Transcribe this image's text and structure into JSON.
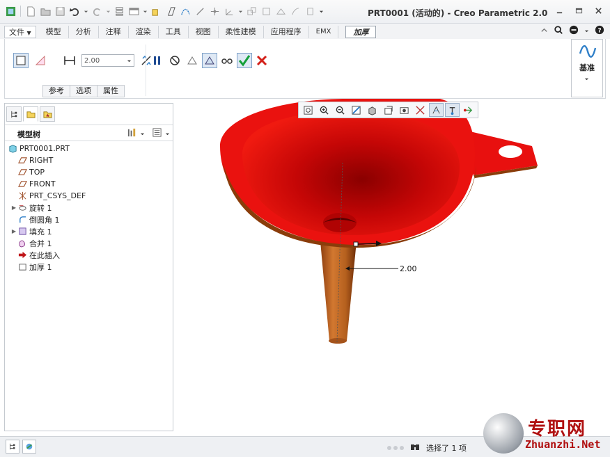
{
  "window": {
    "title": "PRT0001 (活动的) - Creo Parametric 2.0"
  },
  "ribbon_tabs": [
    {
      "label": "文件"
    },
    {
      "label": "模型"
    },
    {
      "label": "分析"
    },
    {
      "label": "注释"
    },
    {
      "label": "渲染"
    },
    {
      "label": "工具"
    },
    {
      "label": "视图"
    },
    {
      "label": "柔性建模"
    },
    {
      "label": "应用程序"
    },
    {
      "label": "EMX"
    },
    {
      "label": "加厚"
    }
  ],
  "ribbon": {
    "thickness_value": "2.00",
    "subtabs": [
      {
        "label": "参考"
      },
      {
        "label": "选项"
      },
      {
        "label": "属性"
      }
    ],
    "datum_label": "基准"
  },
  "model_tree": {
    "title": "模型树",
    "items": [
      {
        "label": "PRT0001.PRT",
        "icon": "part-icon",
        "expandable": false
      },
      {
        "label": "RIGHT",
        "icon": "datum-plane-icon",
        "expandable": false
      },
      {
        "label": "TOP",
        "icon": "datum-plane-icon",
        "expandable": false
      },
      {
        "label": "FRONT",
        "icon": "datum-plane-icon",
        "expandable": false
      },
      {
        "label": "PRT_CSYS_DEF",
        "icon": "csys-icon",
        "expandable": false
      },
      {
        "label": "旋转 1",
        "icon": "revolve-icon",
        "expandable": true
      },
      {
        "label": "倒圆角 1",
        "icon": "round-icon",
        "expandable": false
      },
      {
        "label": "填充 1",
        "icon": "fill-icon",
        "expandable": true
      },
      {
        "label": "合并 1",
        "icon": "merge-icon",
        "expandable": false
      },
      {
        "label": "在此插入",
        "icon": "insert-here-icon",
        "expandable": false
      },
      {
        "label": "加厚 1",
        "icon": "thicken-icon",
        "expandable": false
      }
    ]
  },
  "graphics": {
    "dimension_label": "2.00"
  },
  "status": {
    "text": "选择了 1 项"
  },
  "watermark": {
    "cn": "专职网",
    "en": "Zhuanzhi.Net"
  },
  "colors": {
    "model_red": "#e8100f",
    "stem": "#b85a1a",
    "accent": "#2f7fc8"
  }
}
